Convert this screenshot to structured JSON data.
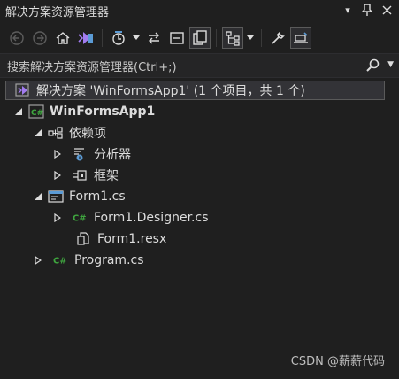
{
  "window": {
    "title": "解决方案资源管理器"
  },
  "search": {
    "placeholder": "搜索解决方案资源管理器(Ctrl+;)"
  },
  "tree": {
    "solution": "解决方案 'WinFormsApp1' (1 个项目，共 1 个)",
    "project": "WinFormsApp1",
    "dependencies": "依赖项",
    "analyzers": "分析器",
    "frameworks": "框架",
    "form1_cs": "Form1.cs",
    "form1_designer": "Form1.Designer.cs",
    "form1_resx": "Form1.resx",
    "program_cs": "Program.cs"
  },
  "watermark": "CSDN @薪薪代码",
  "colors": {
    "csharp_icon": "#3fa63f",
    "vs_purple": "#a27cf0",
    "accent_blue": "#5b9bd5"
  }
}
